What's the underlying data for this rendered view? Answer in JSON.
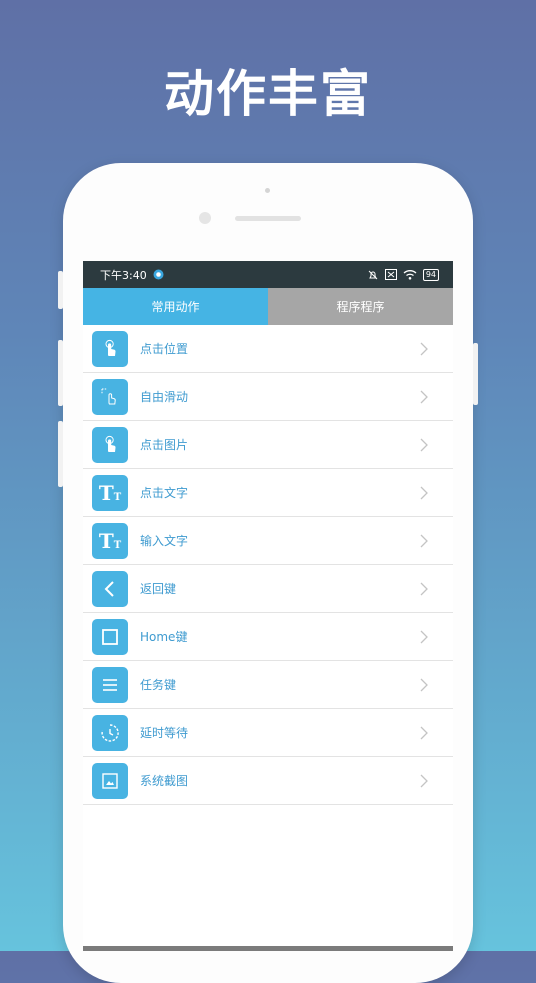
{
  "hero": {
    "title": "动作丰富"
  },
  "status_bar": {
    "time": "下午3:40",
    "battery": "94"
  },
  "tabs": [
    {
      "label": "常用动作",
      "active": true
    },
    {
      "label": "程序程序",
      "active": false
    }
  ],
  "actions": [
    {
      "label": "点击位置",
      "icon": "tap-icon"
    },
    {
      "label": "自由滑动",
      "icon": "swipe-icon"
    },
    {
      "label": "点击图片",
      "icon": "tap-image-icon"
    },
    {
      "label": "点击文字",
      "icon": "text-icon"
    },
    {
      "label": "输入文字",
      "icon": "text-input-icon"
    },
    {
      "label": "返回键",
      "icon": "back-icon"
    },
    {
      "label": "Home键",
      "icon": "home-icon"
    },
    {
      "label": "任务键",
      "icon": "menu-icon"
    },
    {
      "label": "延时等待",
      "icon": "timer-icon"
    },
    {
      "label": "系统截图",
      "icon": "screenshot-icon"
    }
  ],
  "colors": {
    "accent": "#48b3e2",
    "tab_active": "#45b4e4",
    "tab_inactive": "#a6a6a6",
    "status_bar": "#2c3a3f"
  }
}
